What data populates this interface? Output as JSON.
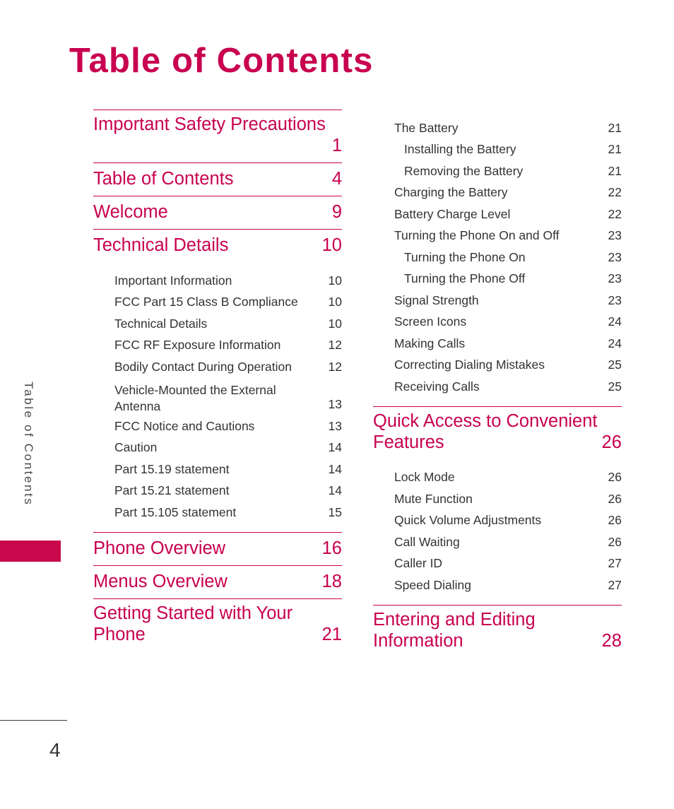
{
  "page": {
    "title": "Table of Contents",
    "folio": "4",
    "side_tab_label": "Table of Contents",
    "accent_color": "#c8004f",
    "tab_color": "#c8094b",
    "body_color": "#333333"
  },
  "columns": {
    "left": {
      "groups": [
        {
          "rule": true,
          "major": {
            "title": "Important Safety Precautions",
            "page": "1",
            "wrapped": true
          },
          "subs": []
        },
        {
          "rule": true,
          "major": {
            "title": "Table of Contents",
            "page": "4",
            "wrapped": false
          },
          "subs": []
        },
        {
          "rule": true,
          "major": {
            "title": "Welcome",
            "page": "9",
            "wrapped": false
          },
          "subs": []
        },
        {
          "rule": true,
          "major": {
            "title": "Technical Details",
            "page": "10",
            "wrapped": false
          },
          "subs": [
            {
              "title": "Important Information",
              "page": "10",
              "level": 1
            },
            {
              "title": "FCC Part 15 Class B Compliance",
              "page": "10",
              "level": 1
            },
            {
              "title": "Technical Details",
              "page": "10",
              "level": 1
            },
            {
              "title": "FCC RF Exposure Information",
              "page": "12",
              "level": 1
            },
            {
              "title": "Bodily Contact During Operation",
              "page": "12",
              "level": 1
            },
            {
              "title": "Vehicle-Mounted the External",
              "title2": "Antenna",
              "page": "13",
              "level": 1,
              "wrapped": true
            },
            {
              "title": "FCC Notice and Cautions",
              "page": "13",
              "level": 1
            },
            {
              "title": "Caution",
              "page": "14",
              "level": 1
            },
            {
              "title": "Part 15.19 statement",
              "page": "14",
              "level": 1
            },
            {
              "title": "Part 15.21 statement",
              "page": "14",
              "level": 1
            },
            {
              "title": "Part 15.105 statement",
              "page": "15",
              "level": 1
            }
          ]
        },
        {
          "rule": true,
          "major": {
            "title": "Phone Overview",
            "page": "16",
            "wrapped": false
          },
          "subs": []
        },
        {
          "rule": true,
          "major": {
            "title": "Menus Overview",
            "page": "18",
            "wrapped": false
          },
          "subs": []
        },
        {
          "rule": true,
          "major": {
            "title": "Getting Started with Your",
            "title2": "Phone",
            "page": "21",
            "wrapped": true,
            "inline_page": true
          },
          "subs": []
        }
      ]
    },
    "right": {
      "groups": [
        {
          "rule": false,
          "major": null,
          "subs": [
            {
              "title": "The Battery",
              "page": "21",
              "level": 1
            },
            {
              "title": "Installing the Battery",
              "page": "21",
              "level": 2
            },
            {
              "title": "Removing the Battery",
              "page": "21",
              "level": 2
            },
            {
              "title": "Charging the Battery",
              "page": "22",
              "level": 1
            },
            {
              "title": "Battery Charge Level",
              "page": "22",
              "level": 1
            },
            {
              "title": "Turning the Phone On and Off",
              "page": "23",
              "level": 1
            },
            {
              "title": "Turning the Phone On",
              "page": "23",
              "level": 2
            },
            {
              "title": "Turning the Phone Off",
              "page": "23",
              "level": 2
            },
            {
              "title": "Signal Strength",
              "page": "23",
              "level": 1
            },
            {
              "title": "Screen Icons",
              "page": "24",
              "level": 1
            },
            {
              "title": "Making Calls",
              "page": "24",
              "level": 1
            },
            {
              "title": "Correcting Dialing Mistakes",
              "page": "25",
              "level": 1
            },
            {
              "title": "Receiving Calls",
              "page": "25",
              "level": 1
            }
          ]
        },
        {
          "rule": true,
          "major": {
            "title": "Quick Access to Convenient",
            "title2": "Features",
            "page": "26",
            "wrapped": true,
            "inline_page": true
          },
          "subs": [
            {
              "title": "Lock Mode",
              "page": "26",
              "level": 1
            },
            {
              "title": "Mute Function",
              "page": "26",
              "level": 1
            },
            {
              "title": "Quick Volume Adjustments",
              "page": "26",
              "level": 1
            },
            {
              "title": "Call Waiting",
              "page": "26",
              "level": 1
            },
            {
              "title": "Caller ID",
              "page": "27",
              "level": 1
            },
            {
              "title": "Speed Dialing",
              "page": "27",
              "level": 1
            }
          ]
        },
        {
          "rule": true,
          "major": {
            "title": "Entering and Editing",
            "title2": "Information",
            "page": "28",
            "wrapped": true,
            "inline_page": true
          },
          "subs": []
        }
      ]
    }
  }
}
